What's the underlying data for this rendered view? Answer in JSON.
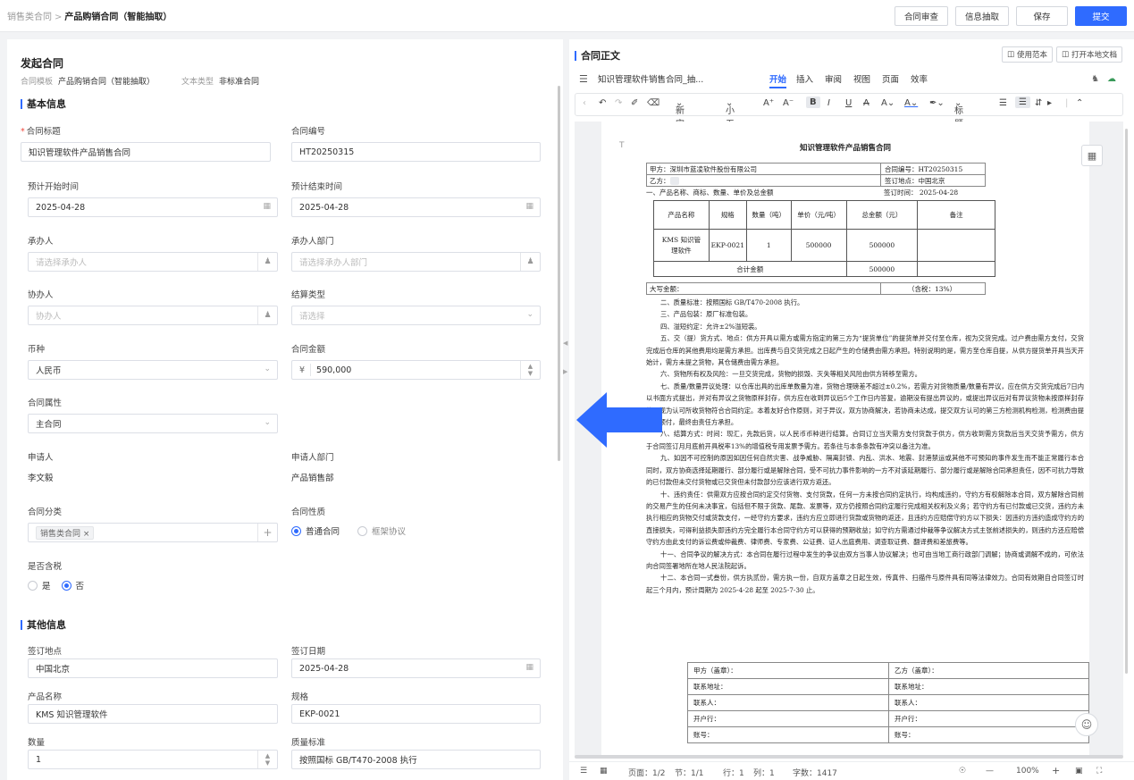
{
  "breadcrumb": {
    "parent": "销售类合同",
    "sep": ">",
    "current": "产品购销合同（智能抽取）"
  },
  "top_actions": {
    "review": "合同审查",
    "extract": "信息抽取",
    "save": "保存",
    "submit": "提交"
  },
  "form": {
    "heading": "发起合同",
    "template_label": "合同模板",
    "template_value": "产品购销合同（智能抽取）",
    "text_type_label": "文本类型",
    "text_type_value": "非标准合同",
    "basic_section": "基本信息",
    "title_label": "合同标题",
    "title_value": "知识管理软件产品销售合同",
    "number_label": "合同编号",
    "number_value": "HT20250315",
    "start_label": "预计开始时间",
    "start_value": "2025-04-28",
    "end_label": "预计结束时间",
    "end_value": "2025-04-28",
    "handler_label": "承办人",
    "handler_ph": "请选择承办人",
    "handler_dept_label": "承办人部门",
    "handler_dept_ph": "请选择承办人部门",
    "cohandler_label": "协办人",
    "cohandler_ph": "协办人",
    "settle_label": "结算类型",
    "settle_ph": "请选择",
    "currency_label": "币种",
    "currency_value": "人民币",
    "amount_label": "合同金额",
    "amount_prefix": "¥",
    "amount_value": "590,000",
    "attr_label": "合同属性",
    "attr_value": "主合同",
    "applicant_label": "申请人",
    "applicant_value": "李文毅",
    "applicant_dept_label": "申请人部门",
    "applicant_dept_value": "产品销售部",
    "category_label": "合同分类",
    "category_tag": "销售类合同 ×",
    "category_add": "+",
    "nature_label": "合同性质",
    "nature_opt1": "普通合同",
    "nature_opt2": "框架协议",
    "tax_label": "是否含税",
    "tax_yes": "是",
    "tax_no": "否",
    "other_section": "其他信息",
    "sign_place_label": "签订地点",
    "sign_place_value": "中国北京",
    "sign_date_label": "签订日期",
    "sign_date_value": "2025-04-28",
    "product_label": "产品名称",
    "product_value": "KMS 知识管理软件",
    "spec_label": "规格",
    "spec_value": "EKP-0021",
    "qty_label": "数量",
    "qty_value": "1",
    "quality_label": "质量标准",
    "quality_value": "按照国标 GB/T470-2008 执行"
  },
  "doc_panel": {
    "title": "合同正文",
    "use_template": "使用范本",
    "open_local": "打开本地文档",
    "doc_name": "知识管理软件销售合同_抽...",
    "tabs": [
      "开始",
      "插入",
      "审阅",
      "视图",
      "页面",
      "效率"
    ],
    "toolbar": {
      "font": "新宋体",
      "size": "小五",
      "heading": "标题"
    },
    "status": {
      "page": "页面：1/2",
      "section": "节：1/1",
      "line": "行：1",
      "col": "列：1",
      "chars": "字数：1417",
      "zoom": "100%"
    }
  },
  "paper": {
    "title": "知识管理软件产品销售合同",
    "party_a": "甲方：深圳市蓝凌软件股份有限公司",
    "contract_no": "合同编号：HT20250315",
    "party_b": "乙方：",
    "sign_place": "签订地点：中国北京",
    "item1": "一、产品名称、商标、数量、单价及总金额",
    "sign_time": "签订时间：   2025-04-28",
    "headers": [
      "产品名称",
      "规格",
      "数量（吨）",
      "单价（元/吨）",
      "总金额（元）",
      "备注"
    ],
    "row": [
      "KMS 知识管理软件",
      "EKP-0021",
      "1",
      "500000",
      "500000",
      ""
    ],
    "total_label": "合计金额",
    "total_value": "500000",
    "capital": "大写金额：",
    "tax_note": "（含税：13%）",
    "clauses": [
      "二、质量标准：按照国标 GB/T470-2008 执行。",
      "三、产品包装：原厂标准包装。",
      "四、溢短约定：允许±2%溢短装。",
      "五、交（提）货方式、地点：供方开具以需方或需方指定的第三方为“提货单位”的提货单并交付至仓库，视为交货完成。过户费由需方支付，交货完成后仓库的其他费用均是需方承担。出库费与自交货完成之日起产生的仓储费由需方承担。特别说明的是，需方至仓库自提，从供方提货单开具当天开始计，需方未提之货物，其仓储费由需方承担。",
      "六、货物所有权及风险：一旦交货完成，货物的损毁、灭失等相关风险由供方转移至需方。",
      "七、质量/数量异议处理：以仓库出具的出库单数量为准，货物合理磅差不超过±0.2%，若需方对货物质量/数量有异议，应在供方交货完成后7日内以书面方式提出，并对有异议之货物原样封存，供方应在收到异议后5个工作日内答复，逾期没有提出异议的，或提出异议后对有异议货物未按原样封存的，视为认可所收货物符合合同约定。本着友好合作原则，对于异议，双方协商解决，若协商未达成，提交双方认可的第三方检测机构检测，检测费由提出人预付，最终由责任方承担。",
      "八、结算方式：时间：现汇，先款后货，以人民币币种进行结算。合同订立当天需方支付货款于供方，供方收到需方货款后当天交货予需方，供方于合同签订月月底前开具税率13%的增值税专用发票予需方。若条往与本条条款有冲突以备注为准。",
      "九、如因不可控制的原因如因任何自然灾害、战争威胁、隔离封锁、内乱、洪水、地震、封港禁运或其他不可预知的事件发生而不能正常履行本合同时，双方协商选择延期履行、部分履行或是解除合同，受不可抗力事件影响的一方不对该延期履行、部分履行或是解除合同承担责任，因不可抗力导致的已付款但未交付货物或已交货但未付款部分应该进行双方返还。",
      "十、违约责任：供需双方应按合同约定交付货物、支付货款，任何一方未按合同约定执行，均构成违约，守约方有权解除本合同，双方解除合同前的交易产生的任何未决事宜，包括但不限于货款、尾款、发票等，双方仍按照合同约定履行完成相关权利及义务；若守约方有已付款或已交货，违约方未执行相应的货物交付或货款支付，一经守约方要求，违约方应立即进行货款或货物的返还，且违约方应赔偿守约方以下损失：因违约方违约造成守约方的直接损失，可得利益损失即违约方完全履行本合同守约方可以获得的预期收益；如守约方需通过仲裁等争议解决方式主张前述损失的，则违约方还应赔偿守约方由此支付的诉讼费或仲裁费、律师费、专家费、公证费、证人出庭费用、调查取证费、翻译费和差旅费等。",
      "十一、合同争议的解决方式：本合同在履行过程中发生的争议由双方当事人协议解决；也可由当地工商行政部门调解；协商或调解不成的，可依法向合同签署地所在地人民法院起诉。",
      "十二、本合同一式叁份，供方执贰份，需方执一份，自双方盖章之日起生效，传真件、扫描件与原件具有同等法律效力。合同有效期自合同签订时起三个月内，预计周期为 2025-4-28 起至 2025-7-30 止。"
    ],
    "sign_rows": [
      [
        "甲方（盖章）：",
        "乙方（盖章）："
      ],
      [
        "联系地址：",
        "联系地址："
      ],
      [
        "联系人：",
        "联系人："
      ],
      [
        "开户行：",
        "开户行："
      ],
      [
        "账号：",
        "账号："
      ]
    ]
  },
  "colors": {
    "accent": "#2f6bff",
    "arrow": "#2f6bff",
    "required": "#f04a3e"
  }
}
